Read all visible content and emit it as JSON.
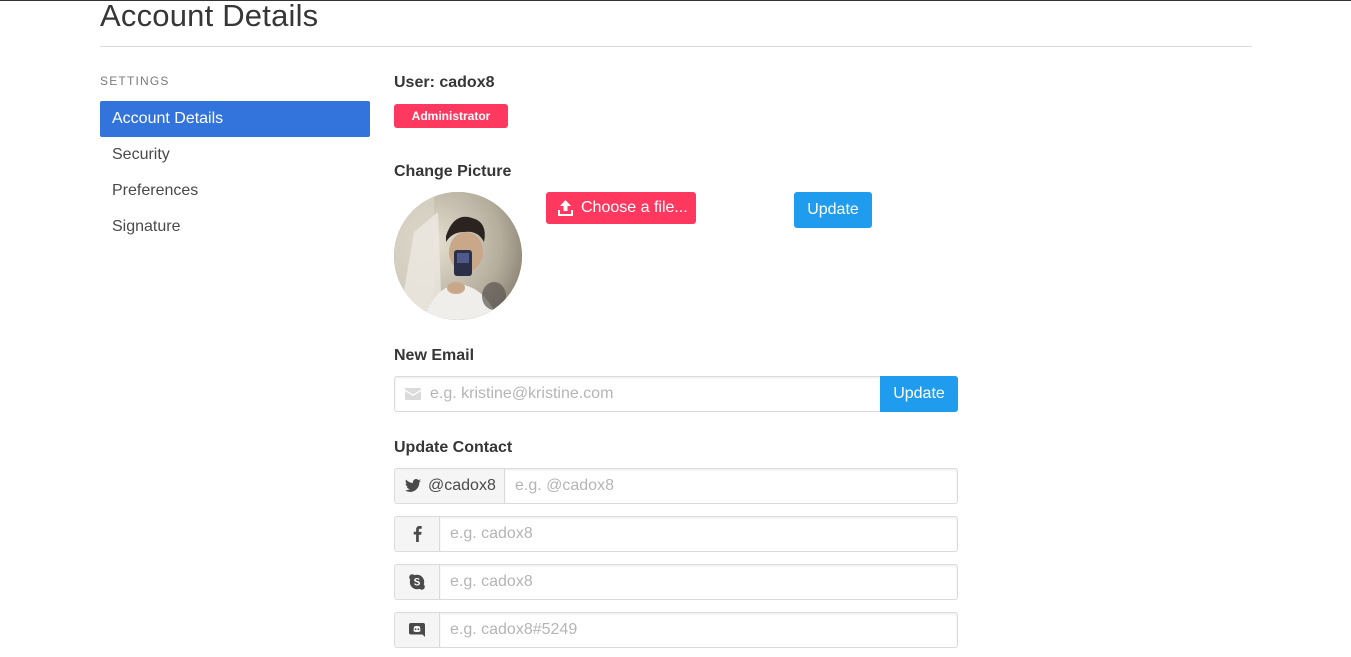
{
  "page": {
    "title": "Account Details"
  },
  "sidebar": {
    "label": "SETTINGS",
    "items": [
      {
        "label": "Account Details",
        "active": true
      },
      {
        "label": "Security",
        "active": false
      },
      {
        "label": "Preferences",
        "active": false
      },
      {
        "label": "Signature",
        "active": false
      }
    ]
  },
  "user": {
    "heading": "User: cadox8",
    "role": "Administrator"
  },
  "picture": {
    "label": "Change Picture",
    "choose_label": "Choose a file...",
    "update_label": "Update",
    "avatar_icon": "user-photo"
  },
  "email": {
    "label": "New Email",
    "placeholder": "e.g. kristine@kristine.com",
    "value": "",
    "update_label": "Update",
    "icon": "envelope-icon"
  },
  "contact": {
    "label": "Update Contact",
    "twitter": {
      "icon": "twitter-icon",
      "prefix": "@cadox8",
      "placeholder": "e.g. @cadox8",
      "value": ""
    },
    "facebook": {
      "icon": "facebook-icon",
      "placeholder": "e.g. cadox8",
      "value": ""
    },
    "skype": {
      "icon": "skype-icon",
      "placeholder": "e.g. cadox8",
      "value": ""
    },
    "discord": {
      "icon": "discord-icon",
      "placeholder": "e.g. cadox8#5249",
      "value": ""
    }
  },
  "colors": {
    "primary": "#3273dc",
    "danger": "#ff3860",
    "info": "#209cee"
  }
}
